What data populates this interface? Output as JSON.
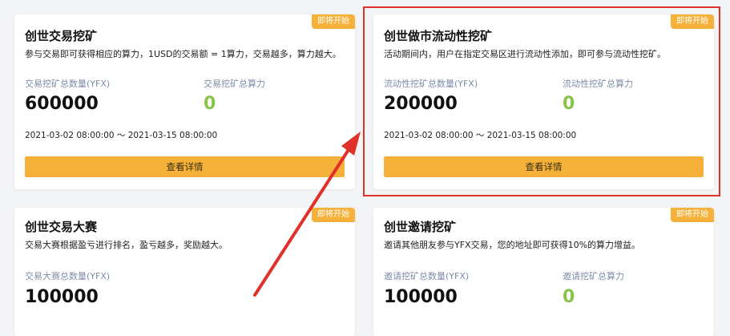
{
  "cards": [
    {
      "badge": "即将开始",
      "title": "创世交易挖矿",
      "desc": "参与交易即可获得相应的算力，1USD的交易额 = 1算力，交易越多，算力越大。",
      "stat1_label": "交易挖矿总数量(YFX)",
      "stat1_value": "600000",
      "stat2_label": "交易挖矿总算力",
      "stat2_value": "0",
      "period": "2021-03-02 08:00:00 ～ 2021-03-15 08:00:00",
      "button": "查看详情"
    },
    {
      "badge": "即将开始",
      "title": "创世做市流动性挖矿",
      "desc": "活动期间内，用户在指定交易区进行流动性添加，即可参与流动性挖矿。",
      "stat1_label": "流动性挖矿总数量(YFX)",
      "stat1_value": "200000",
      "stat2_label": "流动性挖矿总算力",
      "stat2_value": "0",
      "period": "2021-03-02 08:00:00 ～ 2021-03-15 08:00:00",
      "button": "查看详情"
    },
    {
      "badge": "即将开始",
      "title": "创世交易大赛",
      "desc": "交易大赛根据盈亏进行排名，盈亏越多，奖励越大。",
      "stat1_label": "交易大赛总数量(YFX)",
      "stat1_value": "100000"
    },
    {
      "badge": "即将开始",
      "title": "创世邀请挖矿",
      "desc": "邀请其他朋友参与YFX交易，您的地址即可获得10%的算力增益。",
      "stat1_label": "邀请挖矿总数量(YFX)",
      "stat1_value": "100000",
      "stat2_label": "邀请挖矿总算力",
      "stat2_value": "0"
    }
  ],
  "colors": {
    "badge": "#f5b13a",
    "button": "#f5b13a",
    "highlight": "#e0302a",
    "power_value": "#8ac34a",
    "stat_label": "#7a8da8"
  }
}
